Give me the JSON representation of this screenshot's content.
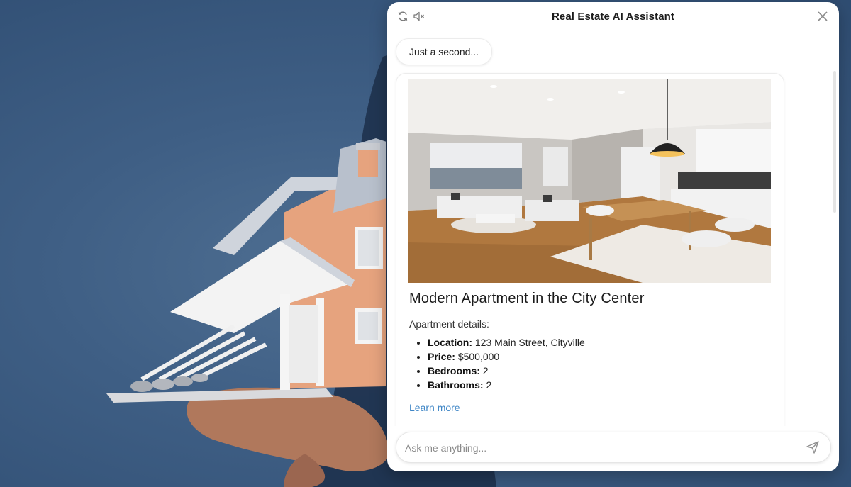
{
  "background": {
    "scene": "house-model-held-in-hand"
  },
  "chat": {
    "title": "Real Estate AI Assistant",
    "icons": {
      "refresh": "refresh-icon",
      "mute": "speaker-muted-icon",
      "close": "close-icon",
      "send": "send-icon"
    },
    "status_message": "Just a second...",
    "listing": {
      "photo": "apartment-interior-photo",
      "title": "Modern Apartment in the City Center",
      "details_heading": "Apartment details:",
      "details": [
        {
          "label": "Location:",
          "value": "123 Main Street, Cityville"
        },
        {
          "label": "Price:",
          "value": "$500,000"
        },
        {
          "label": "Bedrooms:",
          "value": "2"
        },
        {
          "label": "Bathrooms:",
          "value": "2"
        }
      ],
      "link_text": "Learn more"
    },
    "input": {
      "placeholder": "Ask me anything...",
      "value": ""
    },
    "colors": {
      "link": "#3f86c6",
      "title_text": "#1c1c1c",
      "panel": "#ffffff"
    }
  }
}
